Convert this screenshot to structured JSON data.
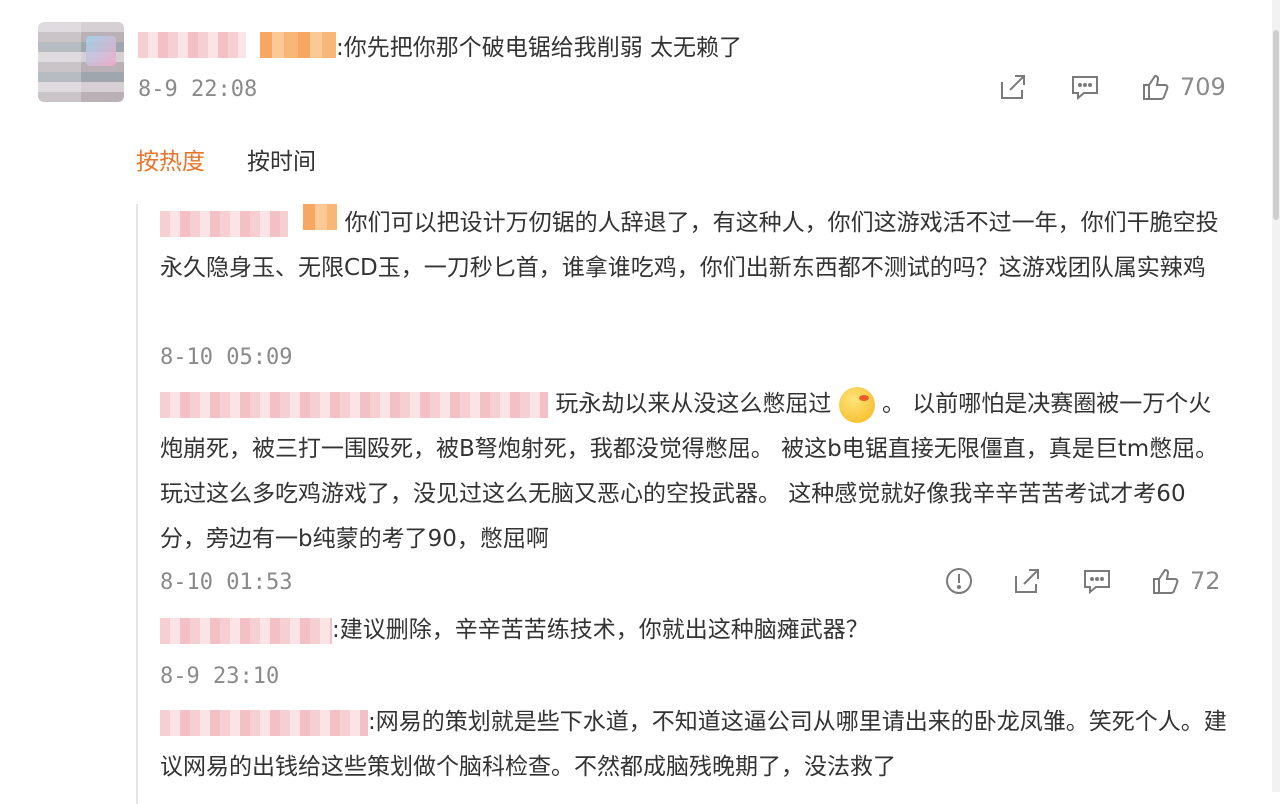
{
  "top_comment": {
    "text": ":你先把你那个破电锯给我削弱 太无赖了",
    "time": "8-9 22:08",
    "like_count": "709"
  },
  "sort": {
    "hot": "按热度",
    "time": "按时间"
  },
  "replies": [
    {
      "text_before_emoji": "你们可以把设计万仞锯的人辞退了，有这种人，你们这游戏活不过一年，你们干脆空投永久隐身玉、无限CD玉，一刀秒匕首，谁拿谁吃鸡，你们出新东西都不测试的吗？这游戏团队属实辣鸡",
      "time": "8-10 05:09"
    },
    {
      "text_before_emoji": "玩永劫以来从没这么憋屈过",
      "text_after_emoji": "。 以前哪怕是决赛圈被一万个火炮崩死，被三打一围殴死，被B弩炮射死，我都没觉得憋屈。 被这b电锯直接无限僵直，真是巨tm憋屈。 玩过这么多吃鸡游戏了，没见过这么无脑又恶心的空投武器。 这种感觉就好像我辛辛苦苦考试才考60分，旁边有一b纯蒙的考了90，憋屈啊",
      "time": "8-10 01:53",
      "like_count": "72"
    },
    {
      "text_before_emoji": ":建议删除，辛辛苦苦练技术，你就出这种脑瘫武器？",
      "time": "8-9 23:10"
    },
    {
      "text_before_emoji": ":网易的策划就是些下水道，不知道这逼公司从哪里请出来的卧龙凤雏。笑死个人。建议网易的出钱给这些策划做个脑科检查。不然都成脑残晚期了，没法救了"
    }
  ],
  "icons": [
    "share-icon",
    "comment-icon",
    "like-icon",
    "report-icon"
  ],
  "colors": {
    "accent": "#e8742a",
    "meta": "#8a8a8a",
    "text": "#333333"
  }
}
